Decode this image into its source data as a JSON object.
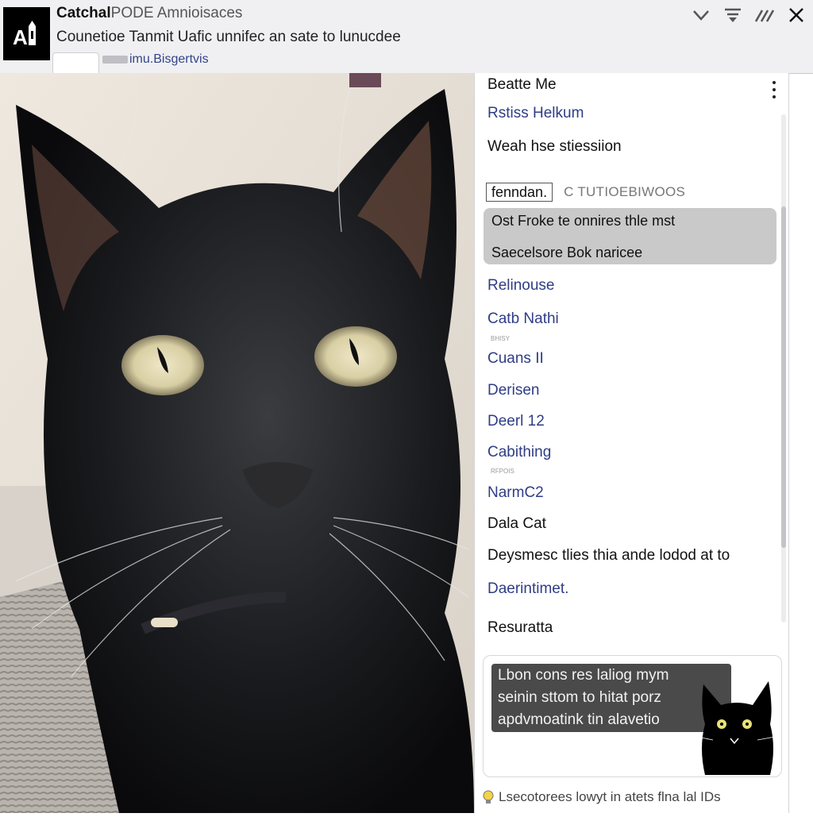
{
  "header": {
    "app_title_bold": "Catchal",
    "app_title_rest": "PODE Amnioisaces",
    "subtitle": "Counetioe Tanmit Uafic unnifec an sate to lunucdee",
    "tab_link": "imu.Bisgertvis"
  },
  "window_controls": [
    {
      "icon": "chevron-down-icon"
    },
    {
      "icon": "filter-icon"
    },
    {
      "icon": "wand-icon"
    },
    {
      "icon": "close-icon"
    }
  ],
  "panel": {
    "title": "Beatte Me",
    "items_top": [
      {
        "label": "Rstiss Helkum",
        "style": "link"
      },
      {
        "label": "Weah hse stiessiion",
        "style": "text"
      }
    ],
    "filter": {
      "input_value": "fenndan.",
      "code": "C TUTIOEBIWOOS"
    },
    "highlight": {
      "line1": "Ost Froke te onnires thle mst",
      "line2": "Saecelsore Bok naricee"
    },
    "items": [
      {
        "label": "Relinouse",
        "style": "link",
        "note": ""
      },
      {
        "label": "Catb Nathi",
        "style": "link",
        "note": "BHISY"
      },
      {
        "label": "Cuans II",
        "style": "link",
        "note": ""
      },
      {
        "label": "Derisen",
        "style": "link",
        "note": ""
      },
      {
        "label": "Deerl 12",
        "style": "link",
        "note": ""
      },
      {
        "label": "Cabithing",
        "style": "link",
        "note": "RFPOIS"
      },
      {
        "label": "NarmC2",
        "style": "link",
        "note": ""
      },
      {
        "label": "Dala Cat",
        "style": "text",
        "note": ""
      },
      {
        "label": "Deysmesc tlies thia ande lodod at to",
        "style": "text",
        "note": ""
      },
      {
        "label": "Daerintimet.",
        "style": "link",
        "note": ""
      },
      {
        "label": "Resuratta",
        "style": "text",
        "note": ""
      }
    ],
    "message": {
      "line1": "Lbon cons res laliog mym",
      "line2": "seinin sttom to hitat porz",
      "line3": "apdvmoatink tin alavetio"
    },
    "footer_note": "Lsecotorees lowyt in atets flna lal IDs"
  },
  "colors": {
    "link": "#2f3d86",
    "header_bg": "#f0f0f2",
    "highlight_bg": "#c9c9c9",
    "bubble_bg": "#4a4a4a"
  }
}
